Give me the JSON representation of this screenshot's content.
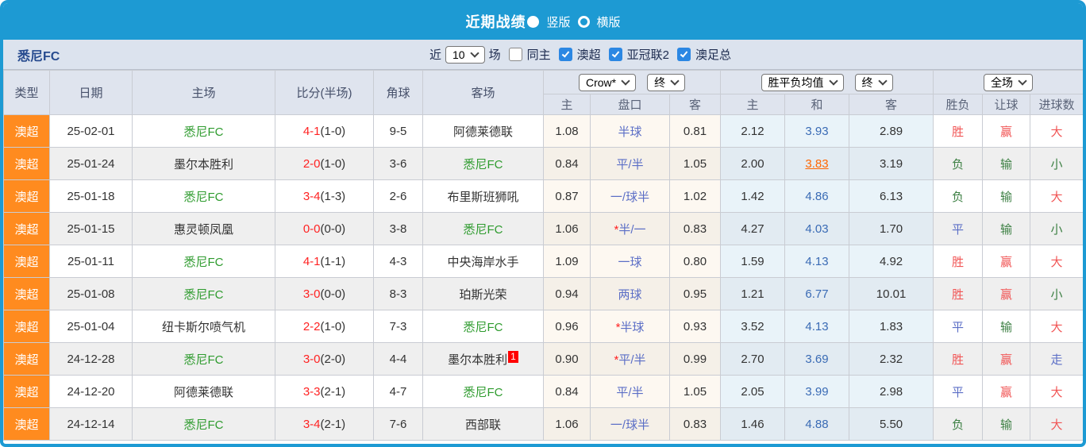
{
  "colors": {
    "accent_blue": "#1d9ad3",
    "type_orange": "#ff8b1f",
    "self_green": "#2e9b2e",
    "score_red": "#ff2222",
    "win_red": "#f15555",
    "lose_green": "#3d8044",
    "draw_blue": "#5b6ec6",
    "avg_blue": "#3a6bb5",
    "hl_orange": "#ff6600",
    "checkbox_blue": "#2b87e3",
    "team_navy": "#274b8f"
  },
  "title_bar": {
    "title": "近期战绩",
    "radio_vertical": "竖版",
    "radio_horizontal": "横版"
  },
  "filter_bar": {
    "team": "悉尼FC",
    "near_label": "近",
    "count_value": "10",
    "games_label": "场",
    "checkboxes": [
      {
        "label": "同主",
        "checked": false
      },
      {
        "label": "澳超",
        "checked": true
      },
      {
        "label": "亚冠联2",
        "checked": true
      },
      {
        "label": "澳足总",
        "checked": true
      }
    ]
  },
  "table": {
    "left_headers": [
      "类型",
      "日期",
      "主场",
      "比分(半场)",
      "角球",
      "客场"
    ],
    "selects": {
      "odds_company": "Crow*",
      "odds_time": "终",
      "avg_label": "胜平负均值",
      "avg_time": "终",
      "scope": "全场"
    },
    "sub_headers": [
      "主",
      "盘口",
      "客",
      "主",
      "和",
      "客",
      "胜负",
      "让球",
      "进球数"
    ],
    "rows": [
      {
        "type": "澳超",
        "date": "25-02-01",
        "home": "悉尼FC",
        "score": "4-1",
        "half": "(1-0)",
        "corner": "9-5",
        "away": "阿德莱德联",
        "away_badge": "",
        "odds_home": "1.08",
        "handicap": "半球",
        "odds_away": "0.81",
        "avg_home": "2.12",
        "avg_draw": "3.93",
        "draw_hl": false,
        "avg_away": "2.89",
        "result": "胜",
        "handicap_result": "赢",
        "goals": "大"
      },
      {
        "type": "澳超",
        "date": "25-01-24",
        "home": "墨尔本胜利",
        "score": "2-0",
        "half": "(1-0)",
        "corner": "3-6",
        "away": "悉尼FC",
        "away_badge": "",
        "odds_home": "0.84",
        "handicap": "平/半",
        "odds_away": "1.05",
        "avg_home": "2.00",
        "avg_draw": "3.83",
        "draw_hl": true,
        "avg_away": "3.19",
        "result": "负",
        "handicap_result": "输",
        "goals": "小"
      },
      {
        "type": "澳超",
        "date": "25-01-18",
        "home": "悉尼FC",
        "score": "3-4",
        "half": "(1-3)",
        "corner": "2-6",
        "away": "布里斯班狮吼",
        "away_badge": "",
        "odds_home": "0.87",
        "handicap": "一/球半",
        "odds_away": "1.02",
        "avg_home": "1.42",
        "avg_draw": "4.86",
        "draw_hl": false,
        "avg_away": "6.13",
        "result": "负",
        "handicap_result": "输",
        "goals": "大"
      },
      {
        "type": "澳超",
        "date": "25-01-15",
        "home": "惠灵顿凤凰",
        "score": "0-0",
        "half": "(0-0)",
        "corner": "3-8",
        "away": "悉尼FC",
        "away_badge": "",
        "odds_home": "1.06",
        "handicap": "*半/一",
        "odds_away": "0.83",
        "avg_home": "4.27",
        "avg_draw": "4.03",
        "draw_hl": false,
        "avg_away": "1.70",
        "result": "平",
        "handicap_result": "输",
        "goals": "小"
      },
      {
        "type": "澳超",
        "date": "25-01-11",
        "home": "悉尼FC",
        "score": "4-1",
        "half": "(1-1)",
        "corner": "4-3",
        "away": "中央海岸水手",
        "away_badge": "",
        "odds_home": "1.09",
        "handicap": "一球",
        "odds_away": "0.80",
        "avg_home": "1.59",
        "avg_draw": "4.13",
        "draw_hl": false,
        "avg_away": "4.92",
        "result": "胜",
        "handicap_result": "赢",
        "goals": "大"
      },
      {
        "type": "澳超",
        "date": "25-01-08",
        "home": "悉尼FC",
        "score": "3-0",
        "half": "(0-0)",
        "corner": "8-3",
        "away": "珀斯光荣",
        "away_badge": "",
        "odds_home": "0.94",
        "handicap": "两球",
        "odds_away": "0.95",
        "avg_home": "1.21",
        "avg_draw": "6.77",
        "draw_hl": false,
        "avg_away": "10.01",
        "result": "胜",
        "handicap_result": "赢",
        "goals": "小"
      },
      {
        "type": "澳超",
        "date": "25-01-04",
        "home": "纽卡斯尔喷气机",
        "score": "2-2",
        "half": "(1-0)",
        "corner": "7-3",
        "away": "悉尼FC",
        "away_badge": "",
        "odds_home": "0.96",
        "handicap": "*半球",
        "odds_away": "0.93",
        "avg_home": "3.52",
        "avg_draw": "4.13",
        "draw_hl": false,
        "avg_away": "1.83",
        "result": "平",
        "handicap_result": "输",
        "goals": "大"
      },
      {
        "type": "澳超",
        "date": "24-12-28",
        "home": "悉尼FC",
        "score": "3-0",
        "half": "(2-0)",
        "corner": "4-4",
        "away": "墨尔本胜利",
        "away_badge": "1",
        "odds_home": "0.90",
        "handicap": "*平/半",
        "odds_away": "0.99",
        "avg_home": "2.70",
        "avg_draw": "3.69",
        "draw_hl": false,
        "avg_away": "2.32",
        "result": "胜",
        "handicap_result": "赢",
        "goals": "走"
      },
      {
        "type": "澳超",
        "date": "24-12-20",
        "home": "阿德莱德联",
        "score": "3-3",
        "half": "(2-1)",
        "corner": "4-7",
        "away": "悉尼FC",
        "away_badge": "",
        "odds_home": "0.84",
        "handicap": "平/半",
        "odds_away": "1.05",
        "avg_home": "2.05",
        "avg_draw": "3.99",
        "draw_hl": false,
        "avg_away": "2.98",
        "result": "平",
        "handicap_result": "赢",
        "goals": "大"
      },
      {
        "type": "澳超",
        "date": "24-12-14",
        "home": "悉尼FC",
        "score": "3-4",
        "half": "(2-1)",
        "corner": "7-6",
        "away": "西部联",
        "away_badge": "",
        "odds_home": "1.06",
        "handicap": "一/球半",
        "odds_away": "0.83",
        "avg_home": "1.46",
        "avg_draw": "4.88",
        "draw_hl": false,
        "avg_away": "5.50",
        "result": "负",
        "handicap_result": "输",
        "goals": "大"
      }
    ]
  }
}
